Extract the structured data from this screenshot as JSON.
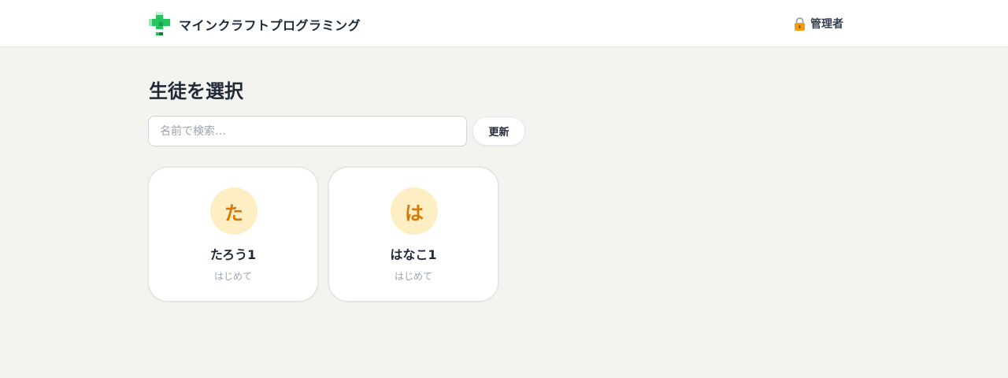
{
  "header": {
    "app_title": "マインクラフトプログラミング",
    "logo_icon": "green-cross-logo-icon",
    "admin_icon": "lock-icon",
    "admin_label": "管理者"
  },
  "main": {
    "page_title": "生徒を選択",
    "search": {
      "placeholder": "名前で検索…",
      "value": ""
    },
    "refresh_label": "更新",
    "students": [
      {
        "initial": "た",
        "name": "たろう1",
        "status": "はじめて"
      },
      {
        "initial": "は",
        "name": "はなこ1",
        "status": "はじめて"
      }
    ]
  },
  "colors": {
    "accent_green": "#22c55e",
    "avatar_bg": "#fdefc3",
    "avatar_text": "#d97706",
    "page_bg": "#f3f3ef"
  }
}
